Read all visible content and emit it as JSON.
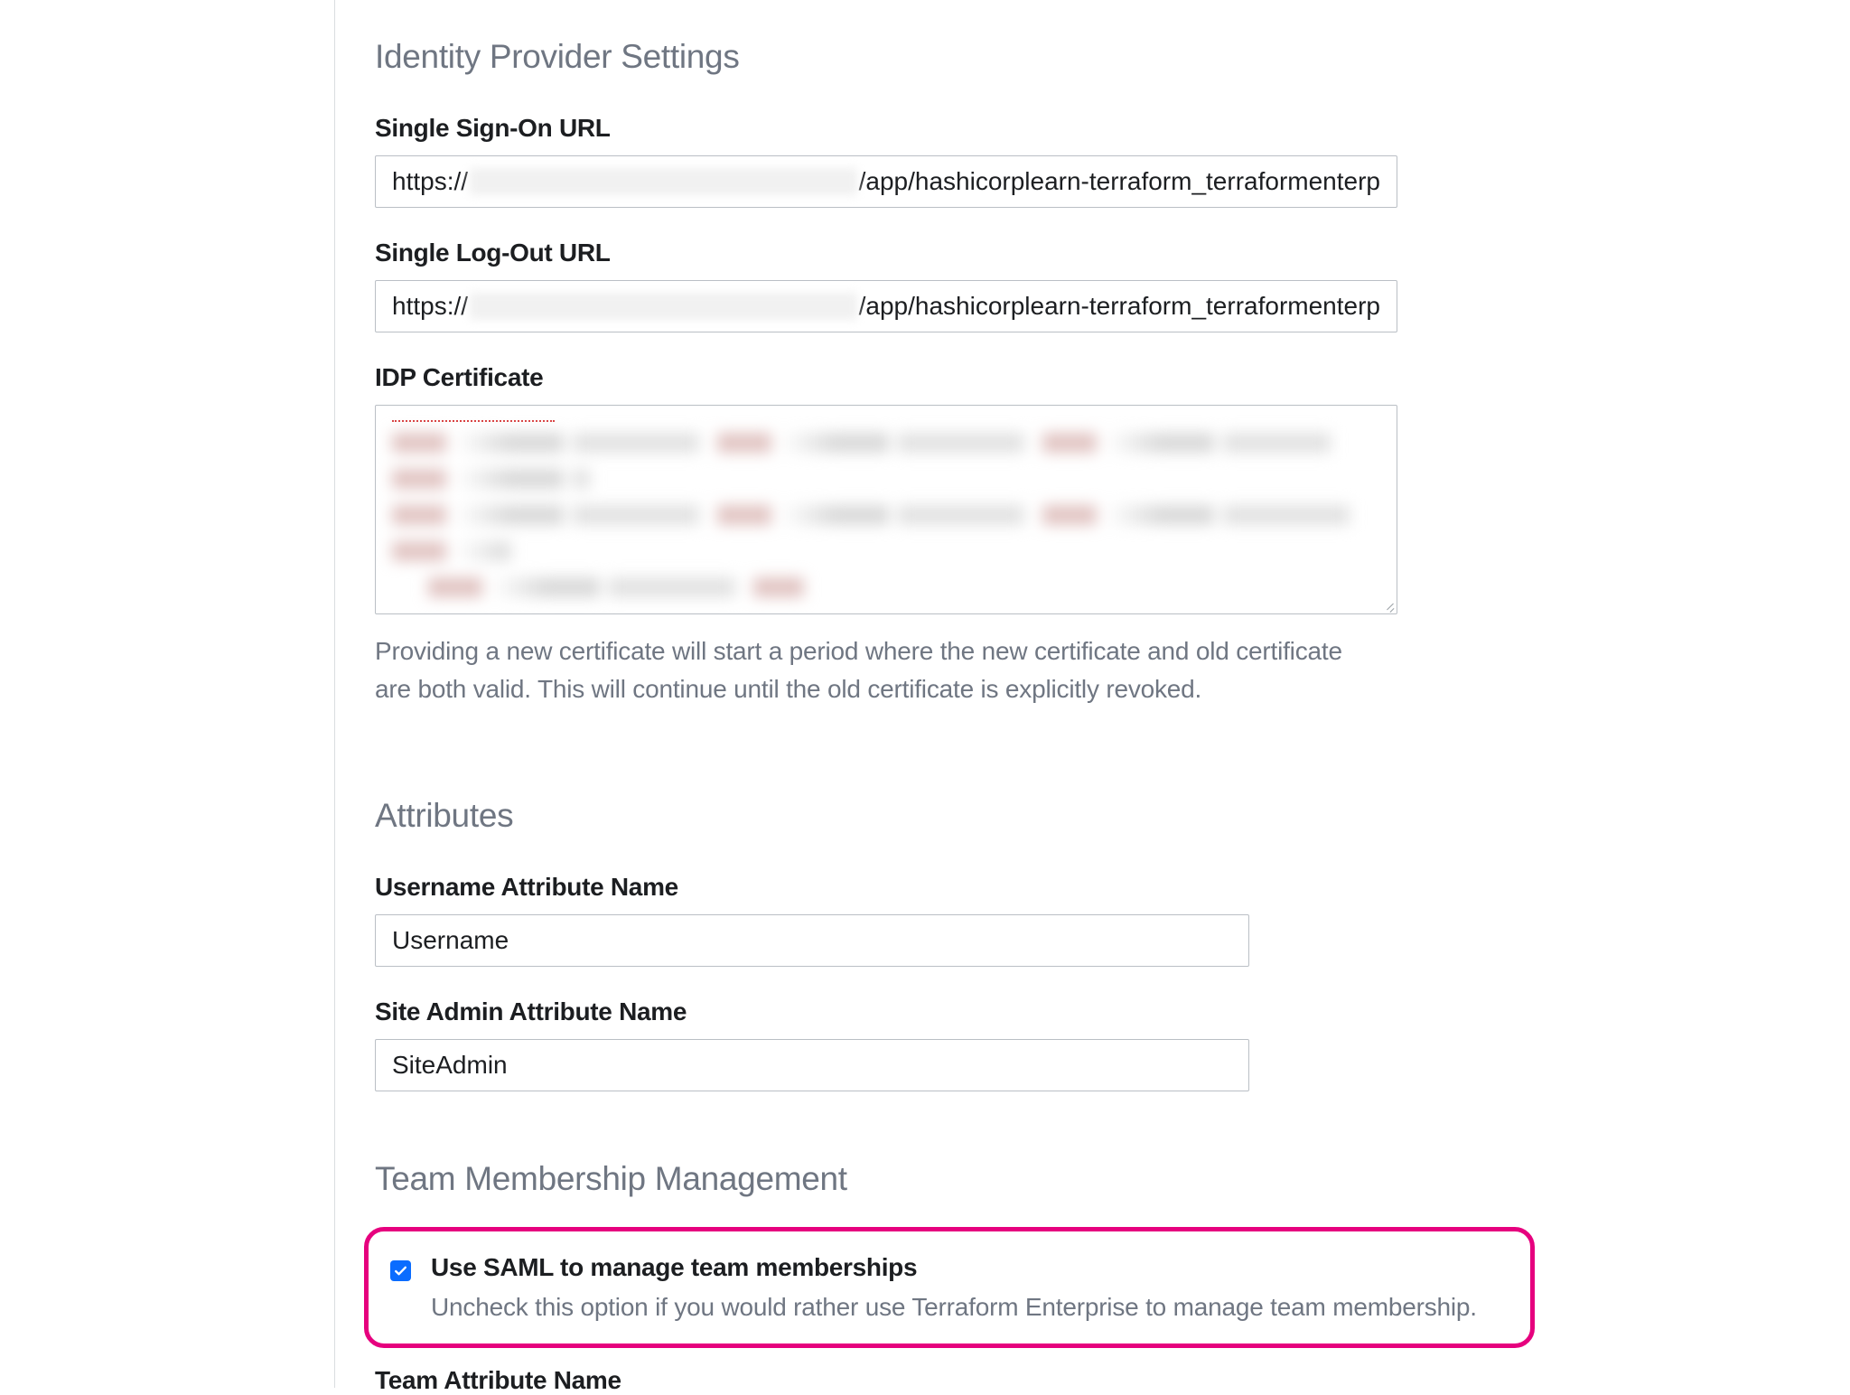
{
  "sections": {
    "idp": {
      "heading": "Identity Provider Settings",
      "sso_url": {
        "label": "Single Sign-On URL",
        "prefix": "https://",
        "suffix": "/app/hashicorplearn-terraform_terraformenterp"
      },
      "slo_url": {
        "label": "Single Log-Out URL",
        "prefix": "https://",
        "suffix": "/app/hashicorplearn-terraform_terraformenterp"
      },
      "cert": {
        "label": "IDP Certificate",
        "helper": "Providing a new certificate will start a period where the new certificate and old certificate are both valid. This will continue until the old certificate is explicitly revoked."
      }
    },
    "attributes": {
      "heading": "Attributes",
      "username": {
        "label": "Username Attribute Name",
        "value": "Username"
      },
      "siteadmin": {
        "label": "Site Admin Attribute Name",
        "value": "SiteAdmin"
      }
    },
    "team": {
      "heading": "Team Membership Management",
      "use_saml": {
        "title": "Use SAML to manage team memberships",
        "desc": "Uncheck this option if you would rather use Terraform Enterprise to manage team membership.",
        "checked": true
      },
      "team_attr": {
        "label": "Team Attribute Name"
      }
    }
  }
}
